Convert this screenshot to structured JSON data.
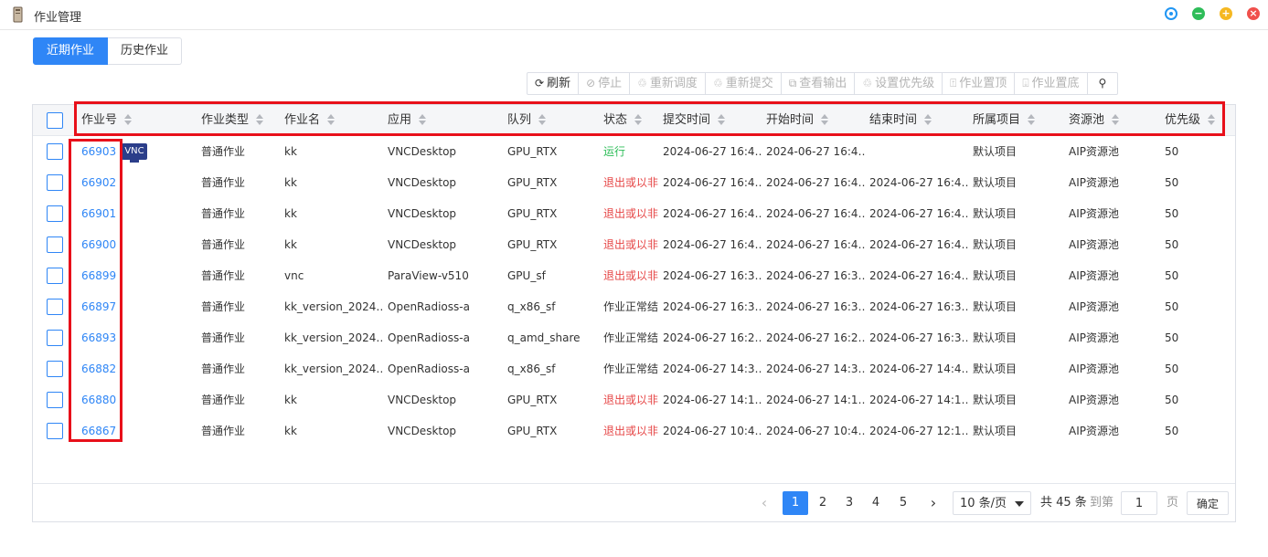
{
  "window": {
    "title": "作业管理",
    "controls": [
      "settings-icon",
      "minimize-icon",
      "maximize-icon",
      "close-icon"
    ]
  },
  "tabs": [
    {
      "label": "近期作业",
      "active": true
    },
    {
      "label": "历史作业",
      "active": false
    }
  ],
  "toolbar": [
    {
      "label": "刷新",
      "icon": "refresh-icon",
      "icon_glyph": "⟳",
      "enabled": true
    },
    {
      "label": "停止",
      "icon": "stop-icon",
      "icon_glyph": "⊘",
      "enabled": false
    },
    {
      "label": "重新调度",
      "icon": "reschedule-icon",
      "icon_glyph": "♲",
      "enabled": false
    },
    {
      "label": "重新提交",
      "icon": "resubmit-icon",
      "icon_glyph": "♲",
      "enabled": false
    },
    {
      "label": "查看输出",
      "icon": "output-icon",
      "icon_glyph": "⧉",
      "enabled": false
    },
    {
      "label": "设置优先级",
      "icon": "priority-icon",
      "icon_glyph": "♲",
      "enabled": false
    },
    {
      "label": "作业置顶",
      "icon": "pin-top-icon",
      "icon_glyph": "⍐",
      "enabled": false
    },
    {
      "label": "作业置底",
      "icon": "pin-bottom-icon",
      "icon_glyph": "⍗",
      "enabled": false
    },
    {
      "label": "",
      "icon": "search-icon",
      "icon_glyph": "⚲",
      "enabled": true
    }
  ],
  "table": {
    "columns": [
      "作业号",
      "作业类型",
      "作业名",
      "应用",
      "队列",
      "状态",
      "提交时间",
      "开始时间",
      "结束时间",
      "所属项目",
      "资源池",
      "优先级"
    ],
    "rows": [
      [
        "66903",
        "普通作业",
        "kk",
        "VNCDesktop",
        "GPU_RTX",
        "运行",
        "2024-06-27 16:4…",
        "2024-06-27 16:4…",
        "",
        "默认项目",
        "AIP资源池",
        "50"
      ],
      [
        "66902",
        "普通作业",
        "kk",
        "VNCDesktop",
        "GPU_RTX",
        "退出或以非",
        "2024-06-27 16:4…",
        "2024-06-27 16:4…",
        "2024-06-27 16:4…",
        "默认项目",
        "AIP资源池",
        "50"
      ],
      [
        "66901",
        "普通作业",
        "kk",
        "VNCDesktop",
        "GPU_RTX",
        "退出或以非",
        "2024-06-27 16:4…",
        "2024-06-27 16:4…",
        "2024-06-27 16:4…",
        "默认项目",
        "AIP资源池",
        "50"
      ],
      [
        "66900",
        "普通作业",
        "kk",
        "VNCDesktop",
        "GPU_RTX",
        "退出或以非",
        "2024-06-27 16:4…",
        "2024-06-27 16:4…",
        "2024-06-27 16:4…",
        "默认项目",
        "AIP资源池",
        "50"
      ],
      [
        "66899",
        "普通作业",
        "vnc",
        "ParaView-v510",
        "GPU_sf",
        "退出或以非",
        "2024-06-27 16:3…",
        "2024-06-27 16:3…",
        "2024-06-27 16:4…",
        "默认项目",
        "AIP资源池",
        "50"
      ],
      [
        "66897",
        "普通作业",
        "kk_version_2024…",
        "OpenRadioss-a",
        "q_x86_sf",
        "作业正常结",
        "2024-06-27 16:3…",
        "2024-06-27 16:3…",
        "2024-06-27 16:3…",
        "默认项目",
        "AIP资源池",
        "50"
      ],
      [
        "66893",
        "普通作业",
        "kk_version_2024…",
        "OpenRadioss-a",
        "q_amd_share",
        "作业正常结",
        "2024-06-27 16:2…",
        "2024-06-27 16:2…",
        "2024-06-27 16:3…",
        "默认项目",
        "AIP资源池",
        "50"
      ],
      [
        "66882",
        "普通作业",
        "kk_version_2024…",
        "OpenRadioss-a",
        "q_x86_sf",
        "作业正常结",
        "2024-06-27 14:3…",
        "2024-06-27 14:3…",
        "2024-06-27 14:4…",
        "默认项目",
        "AIP资源池",
        "50"
      ],
      [
        "66880",
        "普通作业",
        "kk",
        "VNCDesktop",
        "GPU_RTX",
        "退出或以非",
        "2024-06-27 14:1…",
        "2024-06-27 14:1…",
        "2024-06-27 14:1…",
        "默认项目",
        "AIP资源池",
        "50"
      ],
      [
        "66867",
        "普通作业",
        "kk",
        "VNCDesktop",
        "GPU_RTX",
        "退出或以非",
        "2024-06-27 10:4…",
        "2024-06-27 10:4…",
        "2024-06-27 12:1…",
        "默认项目",
        "AIP资源池",
        "50"
      ]
    ],
    "vnc_badge": {
      "row": 0,
      "label": "VNC"
    },
    "status_colors": {
      "运行": "#2ebd59",
      "退出或以非": "#e64545",
      "作业正常结": "#333333"
    }
  },
  "pagination": {
    "pages": [
      "1",
      "2",
      "3",
      "4",
      "5"
    ],
    "current": "1",
    "page_size": "10 条/页",
    "total": "共 45 条",
    "goto_label": "到第",
    "goto_value": "1",
    "page_suffix": "页",
    "confirm": "确定"
  },
  "colors": {
    "accent": "#2f86f6",
    "highlight_box": "#e8101a"
  }
}
